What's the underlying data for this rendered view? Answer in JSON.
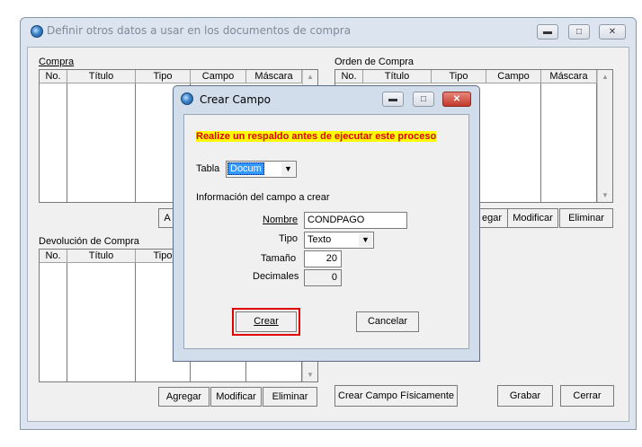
{
  "window": {
    "title": "Definir otros datos a usar en los documentos de compra"
  },
  "sections": {
    "compra": {
      "label": "Compra",
      "columns": [
        "No.",
        "Título",
        "Tipo",
        "Campo",
        "Máscara"
      ]
    },
    "orden": {
      "label": "Orden de Compra",
      "columns": [
        "No.",
        "Título",
        "Tipo",
        "Campo",
        "Máscara"
      ]
    },
    "devolucion": {
      "label": "Devolución de Compra",
      "columns": [
        "No.",
        "Título",
        "Tipo"
      ]
    }
  },
  "buttons": {
    "agregar_partial": "A",
    "orden_agregar_partial": "egar",
    "orden_modificar": "Modificar",
    "orden_eliminar": "Eliminar",
    "dev_agregar": "Agregar",
    "dev_modificar": "Modificar",
    "dev_eliminar": "Eliminar",
    "crear_campo_fisicamente": "Crear Campo Físicamente",
    "grabar": "Grabar",
    "cerrar": "Cerrar"
  },
  "dialog": {
    "title": "Crear Campo",
    "warning": "Realize un respaldo antes de ejecutar este proceso",
    "tabla_label": "Tabla",
    "tabla_value": "Docum",
    "info_label": "Información del campo a crear",
    "nombre_label": "Nombre",
    "nombre_value": "CONDPAGO",
    "tipo_label": "Tipo",
    "tipo_value": "Texto",
    "tamano_label": "Tamaño",
    "tamano_value": "20",
    "decimales_label": "Decimales",
    "decimales_value": "0",
    "crear_button": "Crear",
    "cancelar_button": "Cancelar"
  }
}
